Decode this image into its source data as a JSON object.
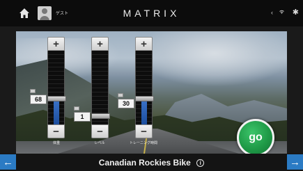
{
  "header": {
    "user_name": "ゲスト",
    "brand": "MATRIX",
    "status_icons": [
      "signal-icon",
      "wifi-icon",
      "bluetooth-icon"
    ]
  },
  "sliders": [
    {
      "id": "weight",
      "label": "体重",
      "value": "68",
      "plus": "+",
      "minus": "−",
      "level": 0.35
    },
    {
      "id": "level",
      "label": "レベル",
      "value": "1",
      "plus": "+",
      "minus": "−",
      "level": 0.0
    },
    {
      "id": "time",
      "label": "トレーニング時間",
      "value": "30",
      "plus": "+",
      "minus": "−",
      "level": 0.35
    }
  ],
  "go_button": {
    "label": "go"
  },
  "footer": {
    "workout_title": "Canadian Rockies Bike",
    "info_glyph": "i",
    "prev_glyph": "←",
    "next_glyph": "→"
  },
  "colors": {
    "accent_blue": "#2b7bc4",
    "go_green": "#1f9a47",
    "slider_fill": "#2f67bf"
  }
}
